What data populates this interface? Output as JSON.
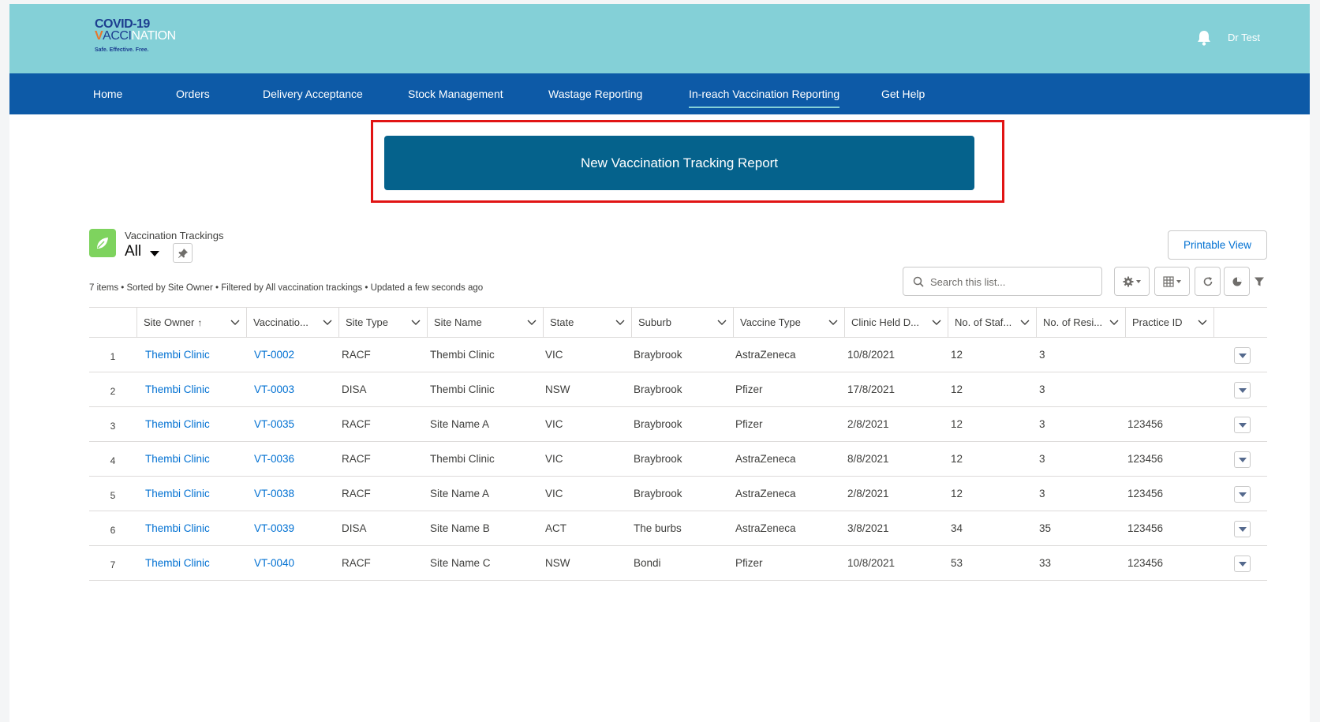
{
  "header": {
    "logo_line1": "COVID-19",
    "logo_line2_v": "V",
    "logo_line2_acc": "ACCI",
    "logo_line2_rest": "NATION",
    "logo_tagline": "Safe. Effective. Free.",
    "user_name": "Dr Test"
  },
  "nav": {
    "items": [
      {
        "label": "Home"
      },
      {
        "label": "Orders"
      },
      {
        "label": "Delivery Acceptance"
      },
      {
        "label": "Stock Management"
      },
      {
        "label": "Wastage Reporting"
      },
      {
        "label": "In-reach Vaccination Reporting"
      },
      {
        "label": "Get Help"
      }
    ],
    "active_index": 5
  },
  "primary_action": {
    "label": "New Vaccination Tracking Report"
  },
  "list_view": {
    "object_name": "Vaccination Trackings",
    "view_name": "All",
    "meta": "7 items • Sorted by Site Owner • Filtered by All vaccination trackings • Updated a few seconds ago",
    "printable_label": "Printable View",
    "search_placeholder": "Search this list..."
  },
  "table": {
    "columns": [
      {
        "label": "Site Owner",
        "sorted": "↑"
      },
      {
        "label": "Vaccinatio..."
      },
      {
        "label": "Site Type"
      },
      {
        "label": "Site Name"
      },
      {
        "label": "State"
      },
      {
        "label": "Suburb"
      },
      {
        "label": "Vaccine Type"
      },
      {
        "label": "Clinic Held D..."
      },
      {
        "label": "No. of Staf..."
      },
      {
        "label": "No. of Resi..."
      },
      {
        "label": "Practice ID"
      }
    ],
    "rows": [
      {
        "n": "1",
        "owner": "Thembi Clinic",
        "vt": "VT-0002",
        "type": "RACF",
        "site": "Thembi Clinic",
        "state": "VIC",
        "suburb": "Braybrook",
        "vaccine": "AstraZeneca",
        "date": "10/8/2021",
        "staff": "12",
        "res": "3",
        "pid": ""
      },
      {
        "n": "2",
        "owner": "Thembi Clinic",
        "vt": "VT-0003",
        "type": "DISA",
        "site": "Thembi Clinic",
        "state": "NSW",
        "suburb": "Braybrook",
        "vaccine": "Pfizer",
        "date": "17/8/2021",
        "staff": "12",
        "res": "3",
        "pid": ""
      },
      {
        "n": "3",
        "owner": "Thembi Clinic",
        "vt": "VT-0035",
        "type": "RACF",
        "site": "Site Name A",
        "state": "VIC",
        "suburb": "Braybrook",
        "vaccine": "Pfizer",
        "date": "2/8/2021",
        "staff": "12",
        "res": "3",
        "pid": "123456"
      },
      {
        "n": "4",
        "owner": "Thembi Clinic",
        "vt": "VT-0036",
        "type": "RACF",
        "site": "Thembi Clinic",
        "state": "VIC",
        "suburb": "Braybrook",
        "vaccine": "AstraZeneca",
        "date": "8/8/2021",
        "staff": "12",
        "res": "3",
        "pid": "123456"
      },
      {
        "n": "5",
        "owner": "Thembi Clinic",
        "vt": "VT-0038",
        "type": "RACF",
        "site": "Site Name A",
        "state": "VIC",
        "suburb": "Braybrook",
        "vaccine": "AstraZeneca",
        "date": "2/8/2021",
        "staff": "12",
        "res": "3",
        "pid": "123456"
      },
      {
        "n": "6",
        "owner": "Thembi Clinic",
        "vt": "VT-0039",
        "type": "DISA",
        "site": "Site Name B",
        "state": "ACT",
        "suburb": "The burbs",
        "vaccine": "AstraZeneca",
        "date": "3/8/2021",
        "staff": "34",
        "res": "35",
        "pid": "123456"
      },
      {
        "n": "7",
        "owner": "Thembi Clinic",
        "vt": "VT-0040",
        "type": "RACF",
        "site": "Site Name C",
        "state": "NSW",
        "suburb": "Bondi",
        "vaccine": "Pfizer",
        "date": "10/8/2021",
        "staff": "53",
        "res": "33",
        "pid": "123456"
      }
    ]
  },
  "icons": {
    "bell": "bell-icon",
    "list": "leaf-icon",
    "pin": "pin-icon",
    "search": "search-icon",
    "settings": "gear-icon",
    "display": "table-view-icon",
    "refresh": "refresh-icon",
    "chart": "pie-chart-icon",
    "filter": "filter-icon"
  },
  "colors": {
    "header_bg": "#84d0d7",
    "nav_bg": "#0d5aa7",
    "primary_btn": "#05628c",
    "highlight": "#e11414",
    "link": "#0070d2",
    "list_icon": "#7ed35e"
  }
}
